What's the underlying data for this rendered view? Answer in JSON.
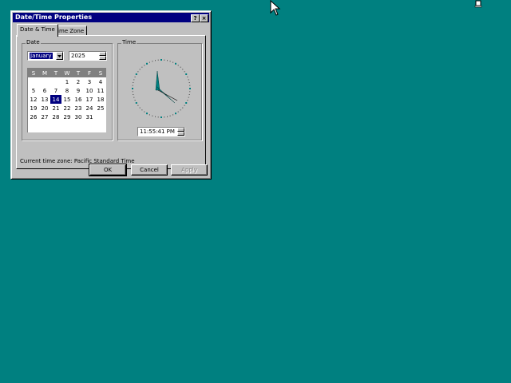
{
  "dialog": {
    "title": "Date/Time Properties",
    "help_glyph": "?",
    "close_glyph": "×",
    "tabs": [
      {
        "label": "Date & Time"
      },
      {
        "label": "Time Zone"
      }
    ],
    "date_group_label": "Date",
    "time_group_label": "Time",
    "month": "January",
    "year": "2025",
    "calendar": {
      "weekday_headers": [
        "S",
        "M",
        "T",
        "W",
        "T",
        "F",
        "S"
      ],
      "weeks": [
        [
          "",
          "",
          "",
          "1",
          "2",
          "3",
          "4"
        ],
        [
          "5",
          "6",
          "7",
          "8",
          "9",
          "10",
          "11"
        ],
        [
          "12",
          "13",
          "14",
          "15",
          "16",
          "17",
          "18"
        ],
        [
          "19",
          "20",
          "21",
          "22",
          "23",
          "24",
          "25"
        ],
        [
          "26",
          "27",
          "28",
          "29",
          "30",
          "31",
          ""
        ]
      ],
      "selected_day": "14"
    },
    "time_value": "11:55:41 PM",
    "timezone_label": "Current time zone:",
    "timezone_value": "Pacific Standard Time",
    "buttons": {
      "ok": "OK",
      "cancel": "Cancel",
      "apply": "Apply"
    }
  },
  "colors": {
    "desktop": "#008080",
    "titlebar": "#000080",
    "face": "#c0c0c0",
    "clock_hands": "#008080"
  },
  "icons": [
    "mouse-cursor-icon",
    "desktop-icon"
  ]
}
